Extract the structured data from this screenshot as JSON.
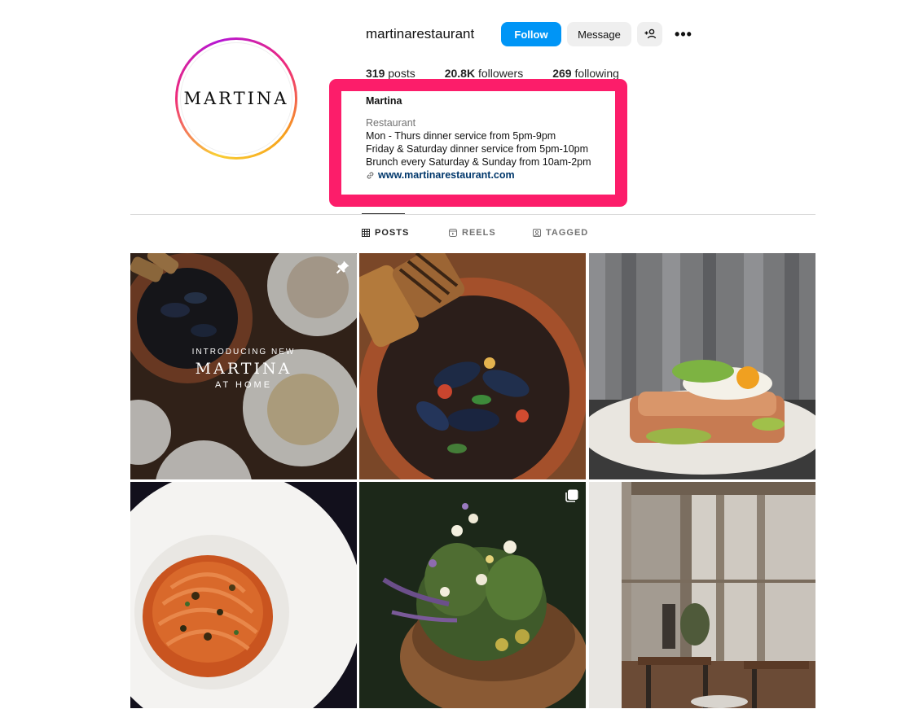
{
  "profile": {
    "username": "martinarestaurant",
    "avatar_text": "MARTINA",
    "follow_label": "Follow",
    "message_label": "Message",
    "more_label": "•••"
  },
  "stats": {
    "posts_count": "319",
    "posts_label": "posts",
    "followers_count": "20.8K",
    "followers_label": "followers",
    "following_count": "269",
    "following_label": "following"
  },
  "bio": {
    "name": "Martina",
    "category": "Restaurant",
    "lines": [
      "Mon - Thurs dinner service from 5pm-9pm",
      "Friday & Saturday dinner service from 5pm-10pm",
      "Brunch every Saturday & Sunday from 10am-2pm"
    ],
    "link": "www.martinarestaurant.com"
  },
  "tabs": [
    {
      "label": "POSTS",
      "icon": "grid-icon",
      "active": true
    },
    {
      "label": "REELS",
      "icon": "reels-icon",
      "active": false
    },
    {
      "label": "TAGGED",
      "icon": "tagged-icon",
      "active": false
    }
  ],
  "posts": [
    {
      "subject": "mussels and plates overhead",
      "overlay_small": "INTRODUCING NEW",
      "overlay_big": "MARTINA",
      "overlay_mid": "AT HOME",
      "badge_icon": "pin-icon"
    },
    {
      "subject": "mussels in clay bowl with grilled bread"
    },
    {
      "subject": "toast topped with fried egg and greens"
    },
    {
      "subject": "spaghetti in white bowl"
    },
    {
      "subject": "herbs and flowers in wooden bowl",
      "badge_icon": "carousel-icon"
    },
    {
      "subject": "rustic wooden dining room"
    }
  ],
  "colors": {
    "follow_button": "#0095f6",
    "highlight_box": "#fc1d6a",
    "link": "#00376b"
  }
}
